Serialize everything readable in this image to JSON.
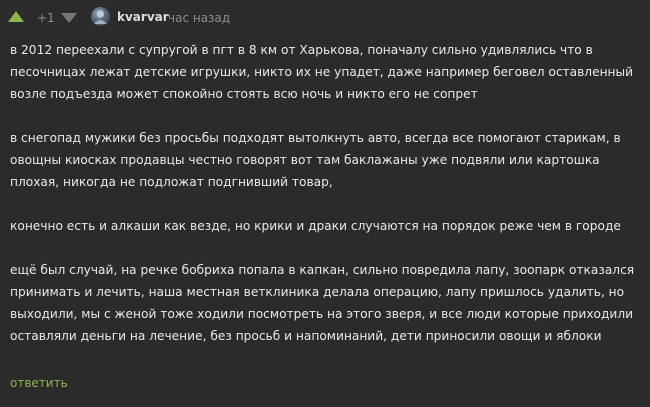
{
  "header": {
    "rating": "+1",
    "username": "kvarvar",
    "time": "час назад"
  },
  "icons": {
    "vote_up": "triangle-up-icon",
    "vote_down": "triangle-down-icon",
    "avatar": "user-avatar"
  },
  "colors": {
    "background": "#2b2b2b",
    "text": "#e9e9e9",
    "muted": "#8d8d8d",
    "accent_green": "#8ab64b"
  },
  "comment": {
    "paragraphs": [
      "в 2012 переехали с супругой в пгт в 8 км от Харькова, поначалу сильно удивлялись что в песочницах лежат детские игрушки, никто их не упадет, даже например беговел оставленный возле подъезда может спокойно стоять всю ночь и никто его не сопрет",
      "в снегопад мужики без просьбы подходят вытолкнуть авто, всегда все помогают старикам, в овощны киосках продавцы честно говорят вот там баклажаны уже подвяли или картошка плохая, никогда не подложат подгнивший товар,",
      "конечно есть и алкаши как везде, но крики и драки случаются на порядок реже чем в городе",
      "ещё был случай, на речке бобриха попала в капкан, сильно повредила лапу, зоопарк отказался принимать и лечить, наша местная ветклиника делала операцию, лапу пришлось удалить, но выходили, мы с женой тоже ходили посмотреть на этого зверя, и все люди которые приходили оставляли деньги на лечение, без просьб и напоминаний, дети приносили овощи и яблоки"
    ]
  },
  "actions": {
    "reply_label": "ответить"
  }
}
